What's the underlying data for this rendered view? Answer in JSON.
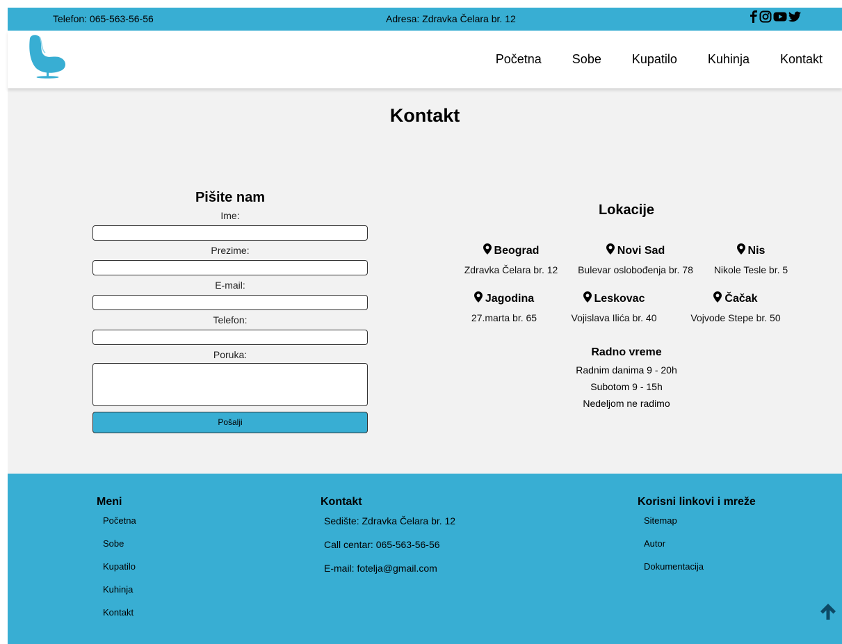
{
  "topbar": {
    "phone": "Telefon: 065-563-56-56",
    "address": "Adresa: Zdravka Čelara br. 12",
    "social_icons": [
      "facebook-icon",
      "instagram-icon",
      "youtube-icon",
      "twitter-icon"
    ]
  },
  "nav": {
    "items": [
      "Početna",
      "Sobe",
      "Kupatilo",
      "Kuhinja",
      "Kontakt"
    ]
  },
  "page": {
    "title": "Kontakt"
  },
  "form": {
    "title": "Pišite nam",
    "fields": [
      {
        "label": "Ime:",
        "value": ""
      },
      {
        "label": "Prezime:",
        "value": ""
      },
      {
        "label": "E-mail:",
        "value": ""
      },
      {
        "label": "Telefon:",
        "value": ""
      },
      {
        "label": "Poruka:",
        "value": ""
      }
    ],
    "submit": "Pošalji"
  },
  "locations": {
    "title": "Lokacije",
    "items": [
      {
        "city": "Beograd",
        "address": "Zdravka Čelara br. 12"
      },
      {
        "city": "Novi Sad",
        "address": "Bulevar oslobođenja br. 78"
      },
      {
        "city": "Nis",
        "address": "Nikole Tesle br. 5"
      },
      {
        "city": "Jagodina",
        "address": "27.marta br. 65"
      },
      {
        "city": "Leskovac",
        "address": "Vojislava Ilića br. 40"
      },
      {
        "city": "Čačak",
        "address": "Vojvode Stepe br. 50"
      }
    ]
  },
  "hours": {
    "title": "Radno vreme",
    "lines": [
      "Radnim danima 9 - 20h",
      "Subotom 9 - 15h",
      "Nedeljom ne radimo"
    ]
  },
  "footer": {
    "menu": {
      "title": "Meni",
      "items": [
        "Početna",
        "Sobe",
        "Kupatilo",
        "Kuhinja",
        "Kontakt"
      ]
    },
    "contact": {
      "title": "Kontakt",
      "items": [
        "Sedište: Zdravka Čelara br. 12",
        "Call centar: 065-563-56-56",
        "E-mail: fotelja@gmail.com"
      ]
    },
    "links": {
      "title": "Korisni linkovi i mreže",
      "items": [
        "Sitemap",
        "Autor",
        "Dokumentacija"
      ]
    }
  },
  "colors": {
    "accent": "#38aed3",
    "background": "#f2f2f2",
    "header": "#ffffff"
  }
}
